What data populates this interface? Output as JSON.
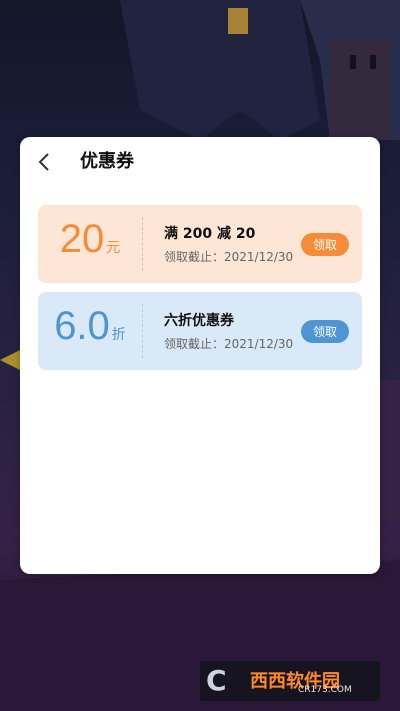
{
  "header": {
    "title": "优惠券"
  },
  "coupons": [
    {
      "amount": "20",
      "unit": "元",
      "name": "满 200 减 20",
      "expiry": "领取截止：2021/12/30",
      "action": "领取"
    },
    {
      "amount": "6.0",
      "unit": "折",
      "name": "六折优惠券",
      "expiry": "领取截止：2021/12/30",
      "action": "领取"
    }
  ],
  "watermark": {
    "logo": "C",
    "brand": "西西软件园",
    "site": "CR173.COM"
  },
  "colors": {
    "orange": "#f58c3a",
    "blue": "#4f95d1",
    "orange_bg": "#fde6d5",
    "blue_bg": "#d9e9f8"
  }
}
